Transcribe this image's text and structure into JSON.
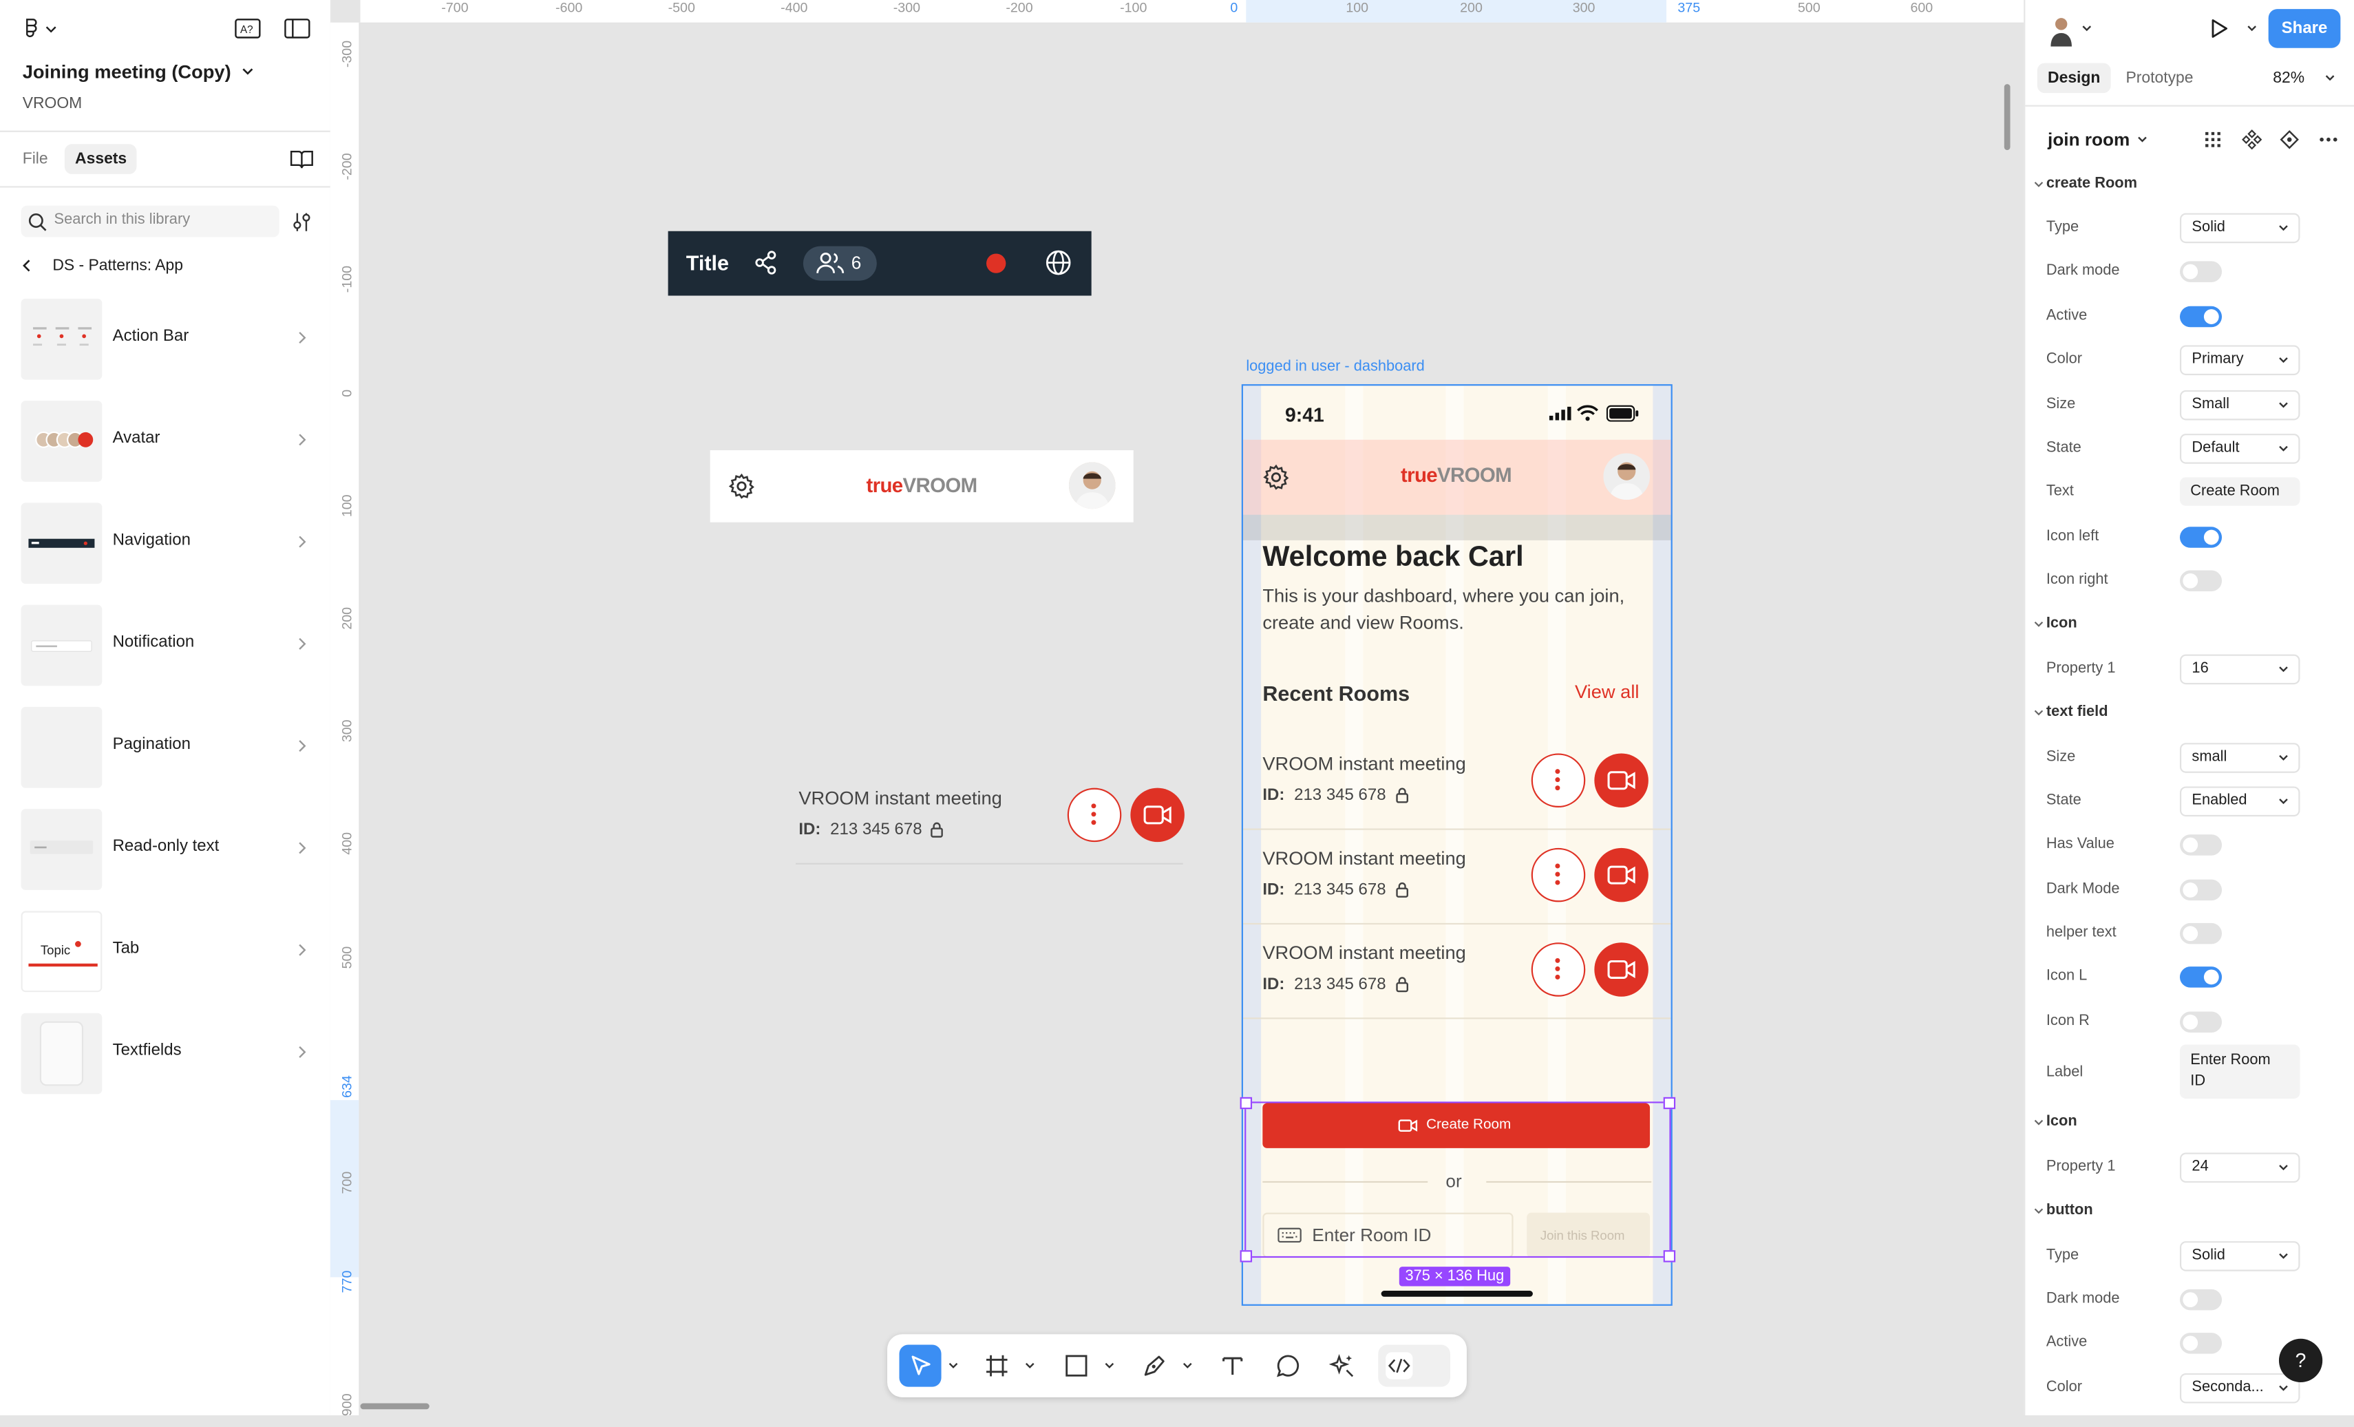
{
  "file": {
    "title": "Joining meeting (Copy)",
    "project": "VROOM"
  },
  "left_panel": {
    "tabs": [
      "File",
      "Assets"
    ],
    "search_placeholder": "Search in this library",
    "library_breadcrumb": "DS - Patterns: App",
    "items": [
      "Action Bar",
      "Avatar",
      "Navigation",
      "Notification",
      "Pagination",
      "Read-only text",
      "Tab",
      "Textfields"
    ],
    "tab_thumb_text": "Topic"
  },
  "rulers": {
    "top": [
      "-700",
      "-600",
      "-500",
      "-400",
      "-300",
      "-200",
      "-100",
      "0",
      "100",
      "200",
      "300",
      "375",
      "500",
      "600"
    ],
    "left": [
      "-300",
      "-200",
      "-100",
      "0",
      "100",
      "200",
      "300",
      "400",
      "500",
      "634",
      "700",
      "770",
      "900"
    ]
  },
  "canvas": {
    "action_bar": {
      "title": "Title",
      "participants": "6"
    },
    "header_logo_prefix": "true",
    "header_logo_suffix": "VROOM",
    "standalone_item": {
      "title": "VROOM instant meeting",
      "id_label": "ID:",
      "id": "213 345 678"
    },
    "frame_label": "logged in user - dashboard",
    "phone": {
      "time": "9:41",
      "welcome": "Welcome back Carl",
      "description": "This is your dashboard, where you can join, create and view Rooms.",
      "recent_title": "Recent Rooms",
      "view_all": "View all",
      "rooms": [
        {
          "title": "VROOM instant meeting",
          "id_label": "ID:",
          "id": "213 345 678"
        },
        {
          "title": "VROOM instant meeting",
          "id_label": "ID:",
          "id": "213 345 678"
        },
        {
          "title": "VROOM instant meeting",
          "id_label": "ID:",
          "id": "213 345 678"
        }
      ],
      "create_button": "Create Room",
      "or": "or",
      "room_input_placeholder": "Enter Room ID",
      "join_button": "Join this Room"
    },
    "selection_size": "375 × 136 Hug"
  },
  "right_panel": {
    "share": "Share",
    "tabs": [
      "Design",
      "Prototype"
    ],
    "zoom": "82%",
    "component": "join room",
    "sections": {
      "create_room": "create Room",
      "icon1": "Icon",
      "text_field": "text field",
      "icon2": "Icon",
      "button": "button"
    },
    "props": {
      "type_label": "Type",
      "type_value": "Solid",
      "dark_mode_label": "Dark mode",
      "active_label": "Active",
      "color_label": "Color",
      "color_value": "Primary",
      "size_label": "Size",
      "size_value": "Small",
      "state_label": "State",
      "state_value": "Default",
      "text_label": "Text",
      "text_value": "Create Room",
      "icon_left_label": "Icon left",
      "icon_right_label": "Icon right",
      "property1_label": "Property 1",
      "property1_value": "16",
      "tf_size_label": "Size",
      "tf_size_value": "small",
      "tf_state_label": "State",
      "tf_state_value": "Enabled",
      "has_value_label": "Has Value",
      "tf_dark_label": "Dark Mode",
      "helper_label": "helper text",
      "icon_l_label": "Icon L",
      "icon_r_label": "Icon R",
      "label_label": "Label",
      "label_value": "Enter Room ID",
      "property1b_label": "Property 1",
      "property1b_value": "24",
      "btn_type_label": "Type",
      "btn_type_value": "Solid",
      "btn_dark_label": "Dark mode",
      "btn_active_label": "Active",
      "btn_color_label": "Color",
      "btn_color_value": "Seconda..."
    },
    "help": "?"
  },
  "colors": {
    "brand_red": "#df3225",
    "selection_blue": "#3b8ef3",
    "selection_purple": "#9747ff",
    "phone_bg": "#fdf8ec",
    "action_bar_bg": "#1d2a36"
  }
}
